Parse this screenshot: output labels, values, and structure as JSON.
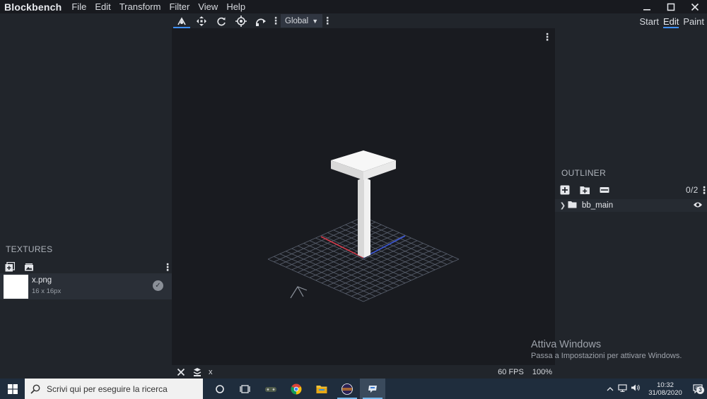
{
  "app": {
    "title": "Blockbench"
  },
  "menu": {
    "items": [
      "File",
      "Edit",
      "Transform",
      "Filter",
      "View",
      "Help"
    ]
  },
  "toolbar": {
    "tools": [
      "move-tool-icon",
      "resize-tool-icon",
      "rotate-tool-icon",
      "pivot-tool-icon",
      "vertex-snap-tool-icon"
    ],
    "space_select": "Global"
  },
  "modes": {
    "items": [
      "Start",
      "Edit",
      "Paint"
    ],
    "active": "Edit"
  },
  "textures": {
    "title": "TEXTURES",
    "items": [
      {
        "name": "x.png",
        "size": "16 x 16px"
      }
    ]
  },
  "outliner": {
    "title": "OUTLINER",
    "count": "0/2",
    "items": [
      {
        "name": "bb_main"
      }
    ]
  },
  "status": {
    "selection": "x",
    "fps": "60 FPS",
    "zoom": "100%"
  },
  "watermark": {
    "title": "Attiva Windows",
    "subtitle": "Passa a Impostazioni per attivare Windows."
  },
  "taskbar": {
    "search_placeholder": "Scrivi qui per eseguire la ricerca",
    "time": "10:32",
    "date": "31/08/2020",
    "notifications": "3"
  },
  "colors": {
    "accent": "#3e90ff",
    "grid": "#5b6270",
    "axis_x": "#d33b4a",
    "axis_z": "#3b56d3",
    "model": "#ececec"
  }
}
